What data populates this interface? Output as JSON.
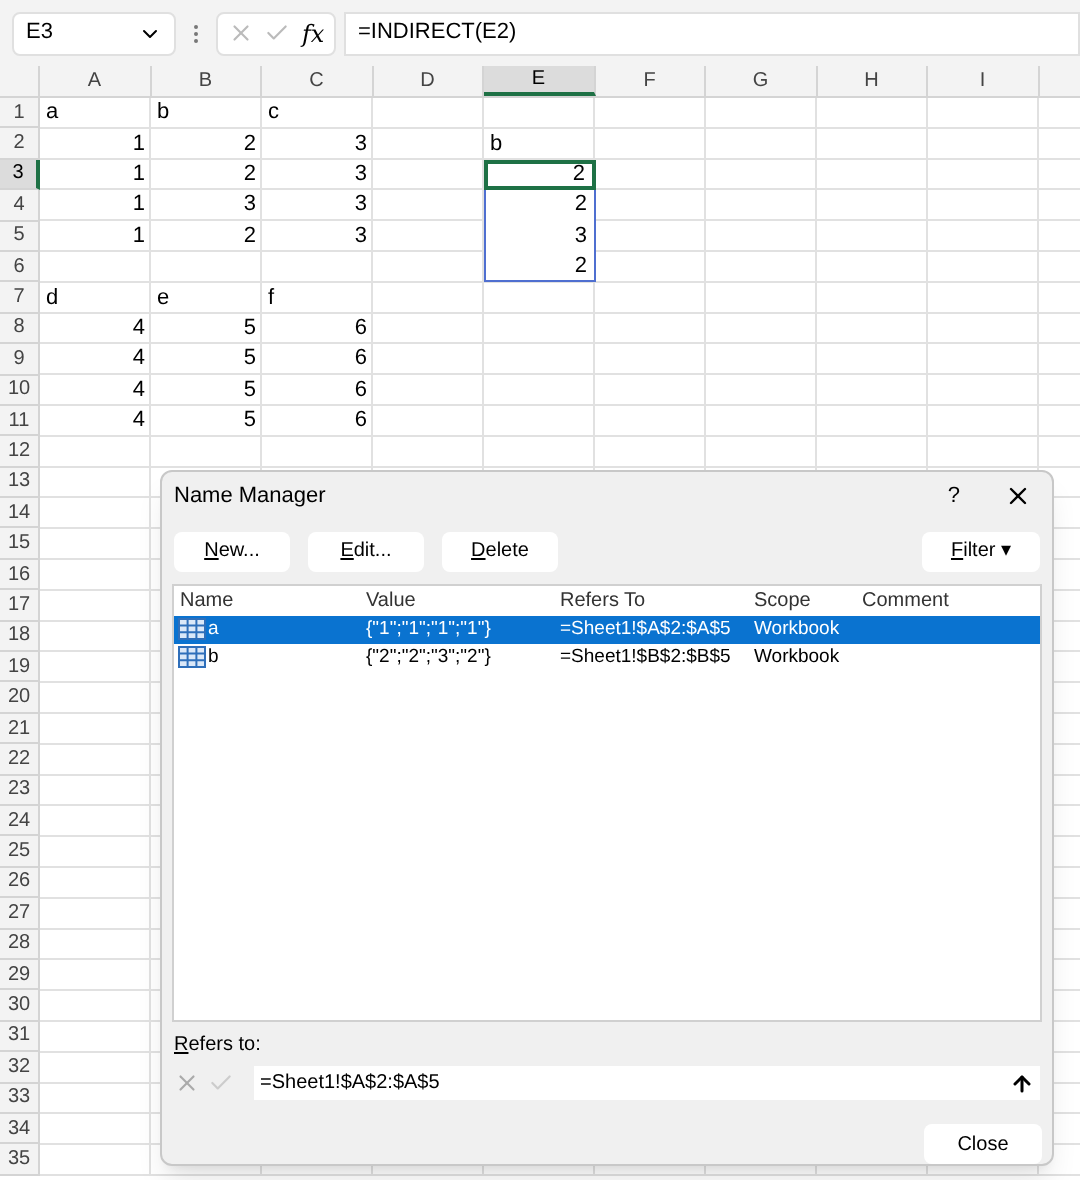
{
  "formula_bar": {
    "name_box": "E3",
    "function_label": "fx",
    "formula": "=INDIRECT(E2)"
  },
  "columns": [
    {
      "label": "A",
      "selected": false
    },
    {
      "label": "B",
      "selected": false
    },
    {
      "label": "C",
      "selected": false
    },
    {
      "label": "D",
      "selected": false
    },
    {
      "label": "E",
      "selected": true
    },
    {
      "label": "F",
      "selected": false
    },
    {
      "label": "G",
      "selected": false
    },
    {
      "label": "H",
      "selected": false
    },
    {
      "label": "I",
      "selected": false
    }
  ],
  "rows": [
    {
      "label": "1",
      "selected": false,
      "cells": [
        {
          "text": "a",
          "kind": "text",
          "selected": false,
          "in_range": false
        },
        {
          "text": "b",
          "kind": "text",
          "selected": false,
          "in_range": false
        },
        {
          "text": "c",
          "kind": "text",
          "selected": false,
          "in_range": false
        }
      ]
    },
    {
      "label": "2",
      "selected": false,
      "cells": [
        {
          "text": "1",
          "kind": "number",
          "selected": false,
          "in_range": false
        },
        {
          "text": "2",
          "kind": "number",
          "selected": false,
          "in_range": false
        },
        {
          "text": "3",
          "kind": "number",
          "selected": false,
          "in_range": false
        },
        null,
        {
          "text": "b",
          "kind": "text",
          "selected": false,
          "in_range": false
        }
      ]
    },
    {
      "label": "3",
      "selected": true,
      "cells": [
        {
          "text": "1",
          "kind": "number",
          "selected": false,
          "in_range": false
        },
        {
          "text": "2",
          "kind": "number",
          "selected": false,
          "in_range": false
        },
        {
          "text": "3",
          "kind": "number",
          "selected": false,
          "in_range": false
        },
        null,
        {
          "text": "2",
          "kind": "number",
          "selected": true,
          "in_range": true
        }
      ]
    },
    {
      "label": "4",
      "selected": false,
      "cells": [
        {
          "text": "1",
          "kind": "number",
          "selected": false,
          "in_range": false
        },
        {
          "text": "3",
          "kind": "number",
          "selected": false,
          "in_range": false
        },
        {
          "text": "3",
          "kind": "number",
          "selected": false,
          "in_range": false
        },
        null,
        {
          "text": "2",
          "kind": "number",
          "selected": false,
          "in_range": true
        }
      ]
    },
    {
      "label": "5",
      "selected": false,
      "cells": [
        {
          "text": "1",
          "kind": "number",
          "selected": false,
          "in_range": false
        },
        {
          "text": "2",
          "kind": "number",
          "selected": false,
          "in_range": false
        },
        {
          "text": "3",
          "kind": "number",
          "selected": false,
          "in_range": false
        },
        null,
        {
          "text": "3",
          "kind": "number",
          "selected": false,
          "in_range": true
        }
      ]
    },
    {
      "label": "6",
      "selected": false,
      "cells": [
        null,
        null,
        null,
        null,
        {
          "text": "2",
          "kind": "number",
          "selected": false,
          "in_range": true
        }
      ]
    },
    {
      "label": "7",
      "selected": false,
      "cells": [
        {
          "text": "d",
          "kind": "text",
          "selected": false,
          "in_range": false
        },
        {
          "text": "e",
          "kind": "text",
          "selected": false,
          "in_range": false
        },
        {
          "text": "f",
          "kind": "text",
          "selected": false,
          "in_range": false
        }
      ]
    },
    {
      "label": "8",
      "selected": false,
      "cells": [
        {
          "text": "4",
          "kind": "number",
          "selected": false,
          "in_range": false
        },
        {
          "text": "5",
          "kind": "number",
          "selected": false,
          "in_range": false
        },
        {
          "text": "6",
          "kind": "number",
          "selected": false,
          "in_range": false
        }
      ]
    },
    {
      "label": "9",
      "selected": false,
      "cells": [
        {
          "text": "4",
          "kind": "number",
          "selected": false,
          "in_range": false
        },
        {
          "text": "5",
          "kind": "number",
          "selected": false,
          "in_range": false
        },
        {
          "text": "6",
          "kind": "number",
          "selected": false,
          "in_range": false
        }
      ]
    },
    {
      "label": "10",
      "selected": false,
      "cells": [
        {
          "text": "4",
          "kind": "number",
          "selected": false,
          "in_range": false
        },
        {
          "text": "5",
          "kind": "number",
          "selected": false,
          "in_range": false
        },
        {
          "text": "6",
          "kind": "number",
          "selected": false,
          "in_range": false
        }
      ]
    },
    {
      "label": "11",
      "selected": false,
      "cells": [
        {
          "text": "4",
          "kind": "number",
          "selected": false,
          "in_range": false
        },
        {
          "text": "5",
          "kind": "number",
          "selected": false,
          "in_range": false
        },
        {
          "text": "6",
          "kind": "number",
          "selected": false,
          "in_range": false
        }
      ]
    },
    {
      "label": "12",
      "selected": false
    },
    {
      "label": "13",
      "selected": false
    },
    {
      "label": "14",
      "selected": false
    },
    {
      "label": "15",
      "selected": false
    },
    {
      "label": "16",
      "selected": false
    },
    {
      "label": "17",
      "selected": false
    },
    {
      "label": "18",
      "selected": false
    },
    {
      "label": "19",
      "selected": false
    },
    {
      "label": "20",
      "selected": false
    },
    {
      "label": "21",
      "selected": false
    },
    {
      "label": "22",
      "selected": false
    },
    {
      "label": "23",
      "selected": false
    },
    {
      "label": "24",
      "selected": false
    },
    {
      "label": "25",
      "selected": false
    },
    {
      "label": "26",
      "selected": false
    },
    {
      "label": "27",
      "selected": false
    },
    {
      "label": "28",
      "selected": false
    },
    {
      "label": "29",
      "selected": false
    },
    {
      "label": "30",
      "selected": false
    },
    {
      "label": "31",
      "selected": false
    },
    {
      "label": "32",
      "selected": false
    },
    {
      "label": "33",
      "selected": false
    },
    {
      "label": "34",
      "selected": false
    },
    {
      "label": "35",
      "selected": false
    }
  ],
  "dialog": {
    "title": "Name Manager",
    "help": "?",
    "buttons": [
      {
        "mnemonic": "N",
        "rest": "ew..."
      },
      {
        "mnemonic": "E",
        "rest": "dit..."
      },
      {
        "mnemonic": "D",
        "rest": "elete"
      }
    ],
    "filter": {
      "mnemonic": "F",
      "rest": "ilter",
      "caret": "▾"
    },
    "list": {
      "columns": [
        "Name",
        "Value",
        "Refers To",
        "Scope",
        "Comment"
      ],
      "rows": [
        {
          "name": "a",
          "value": "{\"1\";\"1\";\"1\";\"1\"}",
          "refers_to": "=Sheet1!$A$2:$A$5",
          "scope": "Workbook",
          "selected": true
        },
        {
          "name": "b",
          "value": "{\"2\";\"2\";\"3\";\"2\"}",
          "refers_to": "=Sheet1!$B$2:$B$5",
          "scope": "Workbook",
          "selected": false
        }
      ]
    },
    "refers_to": {
      "mnemonic": "R",
      "rest": "efers to:",
      "value": "=Sheet1!$A$2:$A$5"
    },
    "close": "Close"
  }
}
